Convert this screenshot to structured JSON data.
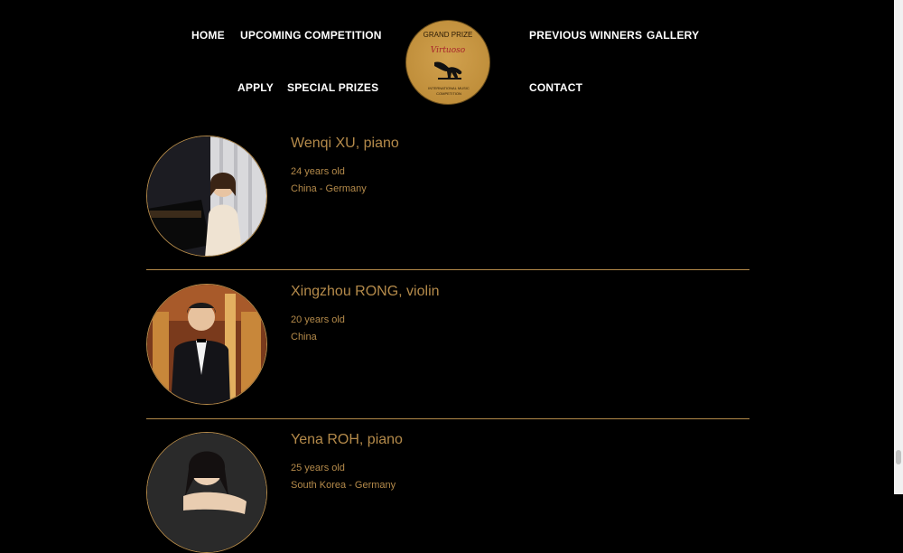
{
  "nav": {
    "home": "HOME",
    "upcoming": "UPCOMING COMPETITION",
    "previous": "PREVIOUS WINNERS",
    "gallery": "GALLERY",
    "apply": "APPLY",
    "special": "SPECIAL PRIZES",
    "contact": "CONTACT"
  },
  "logo": {
    "top": "GRAND PRIZE",
    "script": "Virtuoso",
    "bottom": "INTERNATIONAL MUSIC COMPETITION"
  },
  "winners": [
    {
      "name": "Wenqi XU, piano",
      "age": "24 years old",
      "country": "China - Germany"
    },
    {
      "name": "Xingzhou RONG, violin",
      "age": "20 years old",
      "country": "China"
    },
    {
      "name": "Yena ROH, piano",
      "age": "25 years old",
      "country": "South Korea - Germany"
    }
  ],
  "colors": {
    "background": "#000000",
    "accent": "#b48a4a",
    "logo_gold": "#c9973f"
  }
}
